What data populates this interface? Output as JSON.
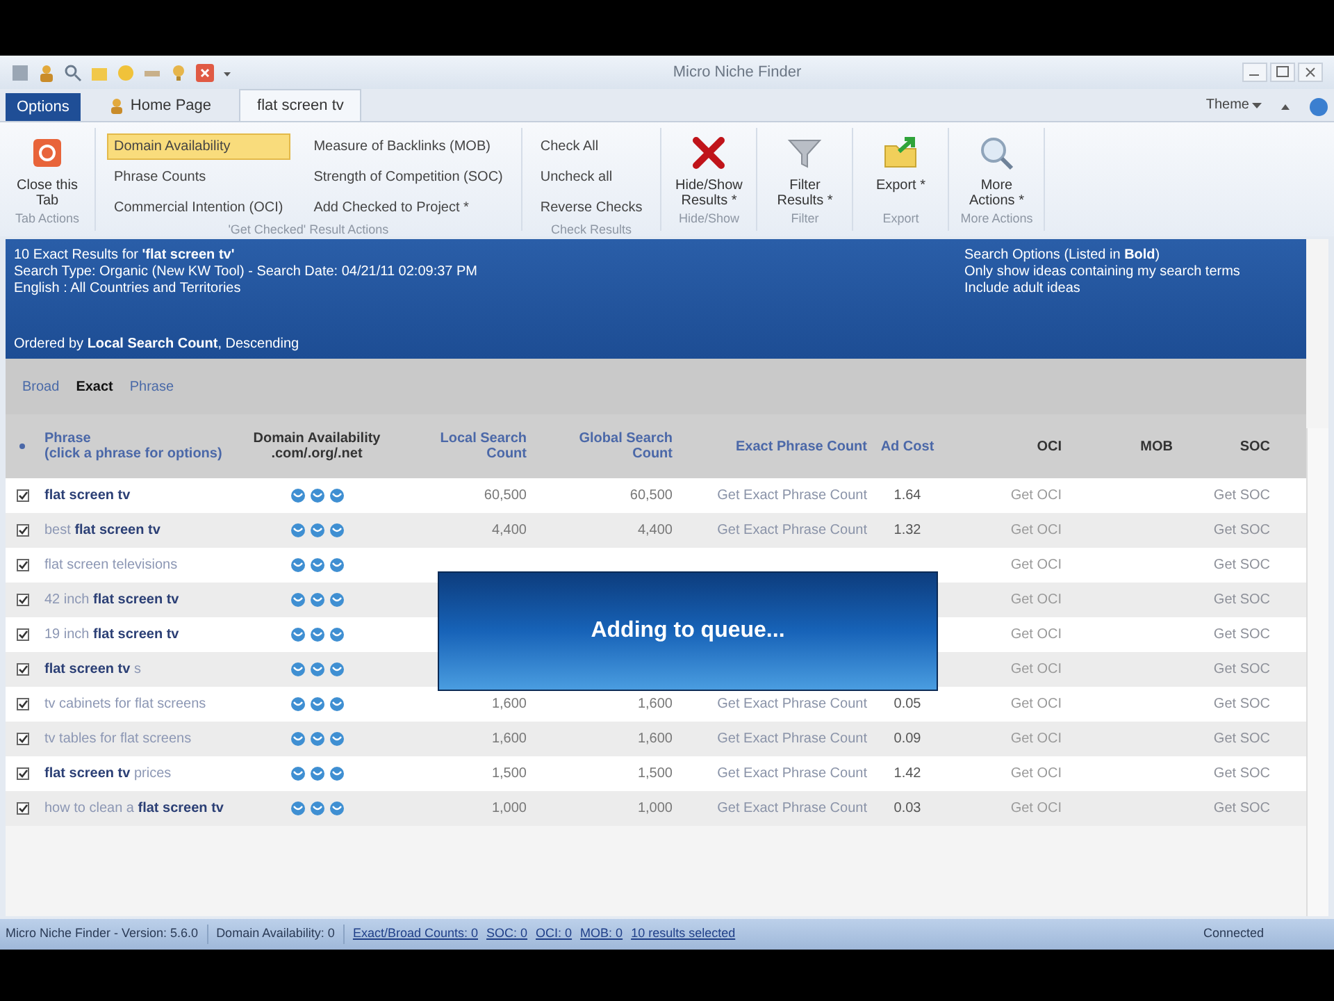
{
  "window": {
    "title": "Micro Niche Finder"
  },
  "tabs": [
    {
      "label": "Options",
      "kind": "menu",
      "selected": false
    },
    {
      "label": "Home Page",
      "kind": "home",
      "selected": false
    },
    {
      "label": "flat screen tv",
      "kind": "tab",
      "selected": true
    }
  ],
  "theme_menu": "Theme",
  "ribbon": {
    "groups": [
      {
        "label": "Tab Actions",
        "kind": "large",
        "buttons": [
          {
            "label": "Close this Tab",
            "kind": "close"
          }
        ]
      },
      {
        "label": "'Get Checked' Result Actions",
        "kind": "list",
        "columns": [
          [
            {
              "label": "Domain Availability",
              "selected": true
            },
            {
              "label": "Phrase Counts",
              "selected": false
            },
            {
              "label": "Commercial Intention (OCI)",
              "selected": false
            }
          ],
          [
            {
              "label": "Measure of Backlinks (MOB)",
              "selected": false
            },
            {
              "label": "Strength of Competition (SOC)",
              "selected": false
            },
            {
              "label": "Add Checked to Project *",
              "selected": false
            }
          ]
        ]
      },
      {
        "label": "Check Results",
        "kind": "list",
        "columns": [
          [
            {
              "label": "Check All",
              "selected": false
            },
            {
              "label": "Uncheck all",
              "selected": false
            },
            {
              "label": "Reverse Checks",
              "selected": false
            }
          ]
        ]
      },
      {
        "label": "Hide/Show",
        "kind": "large",
        "buttons": [
          {
            "label": "Hide/Show Results *",
            "kind": "hide"
          }
        ]
      },
      {
        "label": "Filter",
        "kind": "large",
        "buttons": [
          {
            "label": "Filter Results *",
            "kind": "filter"
          }
        ]
      },
      {
        "label": "Export",
        "kind": "large",
        "buttons": [
          {
            "label": "Export *",
            "kind": "export"
          }
        ]
      },
      {
        "label": "More Actions",
        "kind": "large",
        "buttons": [
          {
            "label": "More Actions *",
            "kind": "more"
          }
        ]
      }
    ]
  },
  "results_header": {
    "title": "10 Exact Results for **'flat screen tv'**",
    "lines": [
      "Search Type: Organic (New KW Tool) - Search Date: 04/21/11 02:09:37 PM",
      "English : All Countries and Territories"
    ],
    "ordered": "Ordered by **Local Search Count**, Descending",
    "options_title": "Search Options (Listed in **Bold**)",
    "options": [
      "Only show ideas containing my search terms",
      "Include adult ideas"
    ]
  },
  "match_types": [
    {
      "label": "Broad",
      "selected": false
    },
    {
      "label": "Exact",
      "selected": true
    },
    {
      "label": "Phrase",
      "selected": false
    }
  ],
  "table": {
    "columns": [
      "Phrase\n(click a phrase for options)",
      "Domain Availability .com/.org/.net",
      "Local Search Count",
      "Global Search Count",
      "Exact Phrase Count",
      "Ad Cost",
      "OCI",
      "MOB",
      "SOC"
    ],
    "rows": [
      {
        "checked": true,
        "phrase": "**flat screen tv**",
        "local": "60,500",
        "global": "60,500",
        "exact": "Get Exact Phrase Count",
        "ad_cost": "1.64",
        "oci": "Get OCI",
        "soc": "Get SOC"
      },
      {
        "checked": true,
        "phrase": "best **flat screen tv**",
        "local": "4,400",
        "global": "4,400",
        "exact": "Get Exact Phrase Count",
        "ad_cost": "1.32",
        "oci": "Get OCI",
        "soc": "Get SOC"
      },
      {
        "checked": true,
        "phrase": "flat screen televisions",
        "oci": "Get OCI",
        "soc": "Get SOC"
      },
      {
        "checked": true,
        "phrase": "42 inch **flat screen tv**",
        "oci": "Get OCI",
        "soc": "Get SOC"
      },
      {
        "checked": true,
        "phrase": "19 inch **flat screen tv**",
        "oci": "Get OCI",
        "soc": "Get SOC"
      },
      {
        "checked": true,
        "phrase": "**flat screen tv** s",
        "oci": "Get OCI",
        "soc": "Get SOC"
      },
      {
        "checked": true,
        "phrase": "tv cabinets for flat screens",
        "local": "1,600",
        "global": "1,600",
        "exact": "Get Exact Phrase Count",
        "ad_cost": "0.05",
        "oci": "Get OCI",
        "soc": "Get SOC"
      },
      {
        "checked": true,
        "phrase": "tv tables for flat screens",
        "local": "1,600",
        "global": "1,600",
        "exact": "Get Exact Phrase Count",
        "ad_cost": "0.09",
        "oci": "Get OCI",
        "soc": "Get SOC"
      },
      {
        "checked": true,
        "phrase": "**flat screen tv** prices",
        "local": "1,500",
        "global": "1,500",
        "exact": "Get Exact Phrase Count",
        "ad_cost": "1.42",
        "oci": "Get OCI",
        "soc": "Get SOC"
      },
      {
        "checked": true,
        "phrase": "how to clean a **flat screen tv**",
        "local": "1,000",
        "global": "1,000",
        "exact": "Get Exact Phrase Count",
        "ad_cost": "0.03",
        "oci": "Get OCI",
        "soc": "Get SOC"
      }
    ]
  },
  "overlay": {
    "message": "Adding to queue..."
  },
  "status_bar": [
    {
      "label": "Micro Niche Finder - Version: 5.6.0",
      "kind": "plain"
    },
    {
      "label": "Domain Availability: 0",
      "kind": "plain"
    },
    {
      "label": "Exact/Broad Counts: 0",
      "kind": "link"
    },
    {
      "label": "SOC: 0",
      "kind": "link"
    },
    {
      "label": "OCI: 0",
      "kind": "link"
    },
    {
      "label": "MOB: 0",
      "kind": "link"
    },
    {
      "label": "10 results selected",
      "kind": "link"
    },
    {
      "label": "Connected",
      "kind": "right"
    }
  ]
}
